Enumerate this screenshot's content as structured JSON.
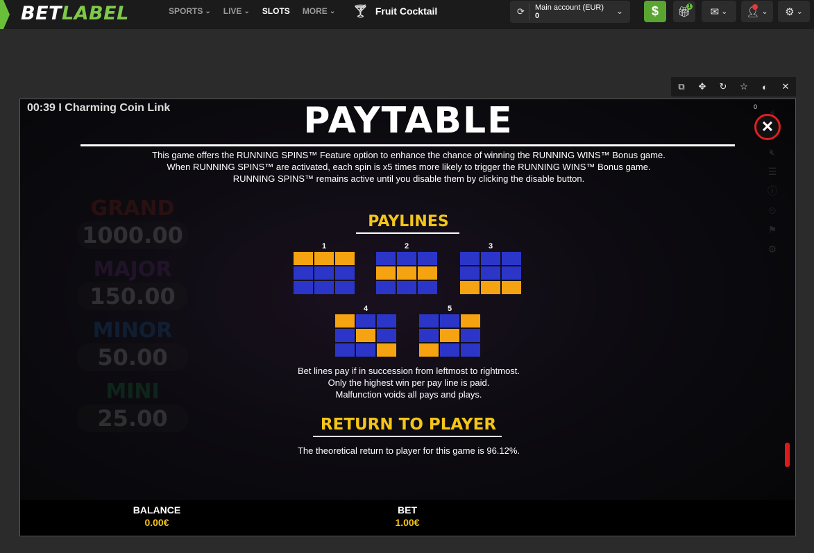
{
  "header": {
    "logo_part1": "BET",
    "logo_part2": "LABEL",
    "nav": [
      {
        "label": "SPORTS",
        "chevron": true
      },
      {
        "label": "LIVE",
        "chevron": true
      },
      {
        "label": "SLOTS",
        "chevron": false
      },
      {
        "label": "MORE",
        "chevron": true
      }
    ],
    "game_title": "Fruit Cocktail",
    "account_label": "Main account (EUR)",
    "account_value": "0",
    "gift_badge": "1",
    "deposit_icon": "$"
  },
  "game": {
    "timer": "00:39 I Charming Coin Link",
    "counter": "0",
    "jackpots": [
      {
        "name": "GRAND",
        "value": "1000.00",
        "color": "#c0392b"
      },
      {
        "name": "MAJOR",
        "value": "150.00",
        "color": "#8e44ad"
      },
      {
        "name": "MINOR",
        "value": "50.00",
        "color": "#2e86de"
      },
      {
        "name": "MINI",
        "value": "25.00",
        "color": "#27ae60"
      }
    ],
    "balance_label": "BALANCE",
    "balance_value": "0.00€",
    "bet_label": "BET",
    "bet_value": "1.00€"
  },
  "paytable": {
    "title": "PAYTABLE",
    "intro_lines": [
      "This game offers the RUNNING SPINS™ Feature option to enhance the chance of winning the RUNNING WINS™ Bonus game.",
      "When RUNNING SPINS™ are activated, each spin is x5 times more likely to trigger the RUNNING WINS™ Bonus game.",
      "RUNNING SPINS™ remains active until you disable them by clicking the disable button."
    ],
    "paylines_title": "PAYLINES",
    "paylines": [
      {
        "number": "1",
        "pattern": [
          [
            1,
            1,
            1
          ],
          [
            0,
            0,
            0
          ],
          [
            0,
            0,
            0
          ]
        ]
      },
      {
        "number": "2",
        "pattern": [
          [
            0,
            0,
            0
          ],
          [
            1,
            1,
            1
          ],
          [
            0,
            0,
            0
          ]
        ]
      },
      {
        "number": "3",
        "pattern": [
          [
            0,
            0,
            0
          ],
          [
            0,
            0,
            0
          ],
          [
            1,
            1,
            1
          ]
        ]
      },
      {
        "number": "4",
        "pattern": [
          [
            1,
            0,
            0
          ],
          [
            0,
            1,
            0
          ],
          [
            0,
            0,
            1
          ]
        ]
      },
      {
        "number": "5",
        "pattern": [
          [
            0,
            0,
            1
          ],
          [
            0,
            1,
            0
          ],
          [
            1,
            0,
            0
          ]
        ]
      }
    ],
    "rules_lines": [
      "Bet lines pay if in succession from leftmost to rightmost.",
      "Only the highest win per pay line is paid.",
      "Malfunction voids all pays and plays."
    ],
    "rtp_title": "RETURN TO PLAYER",
    "rtp_text": "The theoretical return to player for this game is 96.12%."
  },
  "colors": {
    "brand_green": "#6abf3a",
    "accent_yellow": "#f5c518",
    "payline_blue": "#2b36c9",
    "payline_orange": "#f5a311",
    "close_red": "#e02020"
  },
  "icons": {
    "window_tools": [
      "popout-icon",
      "move-icon",
      "reload-icon",
      "star-icon",
      "toggle-icon",
      "close-icon"
    ]
  }
}
